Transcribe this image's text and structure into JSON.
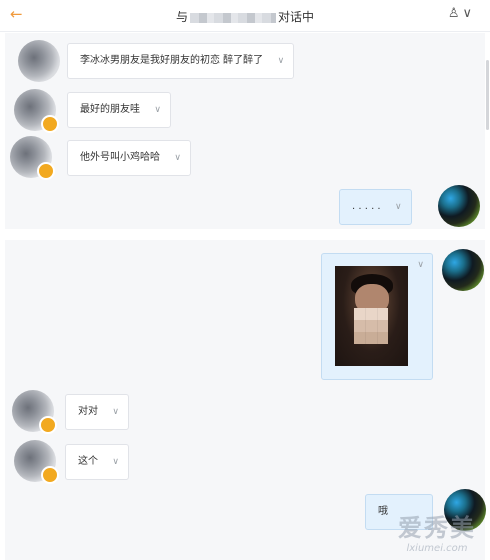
{
  "header": {
    "back_icon": "←",
    "title_prefix": "与",
    "title_suffix": "对话中",
    "user_icon": "♙",
    "dropdown_icon": "∨"
  },
  "conversation_1": {
    "messages": [
      {
        "sender": "other",
        "text": "李冰冰男朋友是我好朋友的初恋 醉了醉了"
      },
      {
        "sender": "other",
        "text": "最好的朋友哇"
      },
      {
        "sender": "other",
        "text": "他外号叫小鸡哈哈"
      },
      {
        "sender": "self",
        "text": ". . . . ."
      }
    ]
  },
  "conversation_2": {
    "messages": [
      {
        "sender": "self",
        "type": "image"
      },
      {
        "sender": "other",
        "text": "对对"
      },
      {
        "sender": "other",
        "text": "这个"
      },
      {
        "sender": "self",
        "text": "哦"
      }
    ]
  },
  "icons": {
    "chevron": "∨"
  },
  "watermark": {
    "line1": "爱秀美",
    "line2": "lxiumei.com"
  }
}
